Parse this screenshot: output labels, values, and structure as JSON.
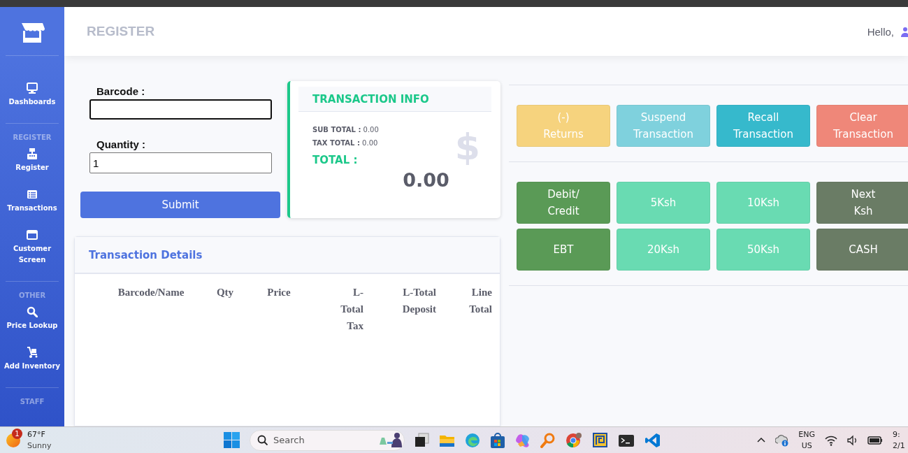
{
  "sidebar": {
    "items": [
      {
        "kind": "link",
        "label": "Dashboards"
      },
      {
        "kind": "heading",
        "label": "REGISTER"
      },
      {
        "kind": "link",
        "label": "Register"
      },
      {
        "kind": "link",
        "label": "Transactions"
      },
      {
        "kind": "link",
        "label": "Customer Screen"
      },
      {
        "kind": "heading",
        "label": "OTHER"
      },
      {
        "kind": "link",
        "label": "Price Lookup"
      },
      {
        "kind": "link",
        "label": "Add Inventory"
      },
      {
        "kind": "heading",
        "label": "STAFF"
      }
    ]
  },
  "header": {
    "title": "REGISTER",
    "greeting": "Hello,"
  },
  "form": {
    "fields": [
      {
        "label": "Barcode :",
        "focused": true
      },
      {
        "label": "Quantity :",
        "value": "1",
        "focused": false
      }
    ],
    "submit": "Submit"
  },
  "transaction_info": {
    "title": "TRANSACTION INFO",
    "lines": [
      "**SUB TOTAL :** 0.00",
      "**TAX TOTAL :** 0.00"
    ],
    "total_label": "TOTAL :",
    "total": "0.00",
    "icon_char": "$"
  },
  "transaction_details": {
    "title": "Transaction Details",
    "columns": [
      "Barcode/Name",
      "Qty",
      "Price",
      "L-Total Tax",
      "L-Total Deposit",
      "Line Total"
    ]
  },
  "action_buttons": [
    {
      "label": "(-) Returns",
      "color": "#f6d37e"
    },
    {
      "label": "Suspend Transaction",
      "color": "#7fd1dd"
    },
    {
      "label": "Recall Transaction",
      "color": "#36b9cc"
    },
    {
      "label": "Clear Transaction",
      "color": "#ef8779"
    }
  ],
  "payment_buttons": [
    {
      "label": "Debit/ Credit",
      "color": "#5a9a56"
    },
    {
      "label": "5Ksh",
      "color": "#69dbb2"
    },
    {
      "label": "10Ksh",
      "color": "#69dbb2"
    },
    {
      "label": "Next Ksh",
      "color": "#6a7c65"
    },
    {
      "label": "EBT",
      "color": "#5a9a56"
    },
    {
      "label": "20Ksh",
      "color": "#69dbb2"
    },
    {
      "label": "50Ksh",
      "color": "#69dbb2"
    },
    {
      "label": "CASH",
      "color": "#6a7c65"
    }
  ],
  "taskbar": {
    "weather": {
      "badge": "1",
      "temperature": "67°F",
      "condition": "Sunny"
    },
    "search": {
      "placeholder": "Search"
    },
    "language": [
      "ENG",
      "US"
    ],
    "clock": [
      "9:",
      "2/1"
    ]
  }
}
